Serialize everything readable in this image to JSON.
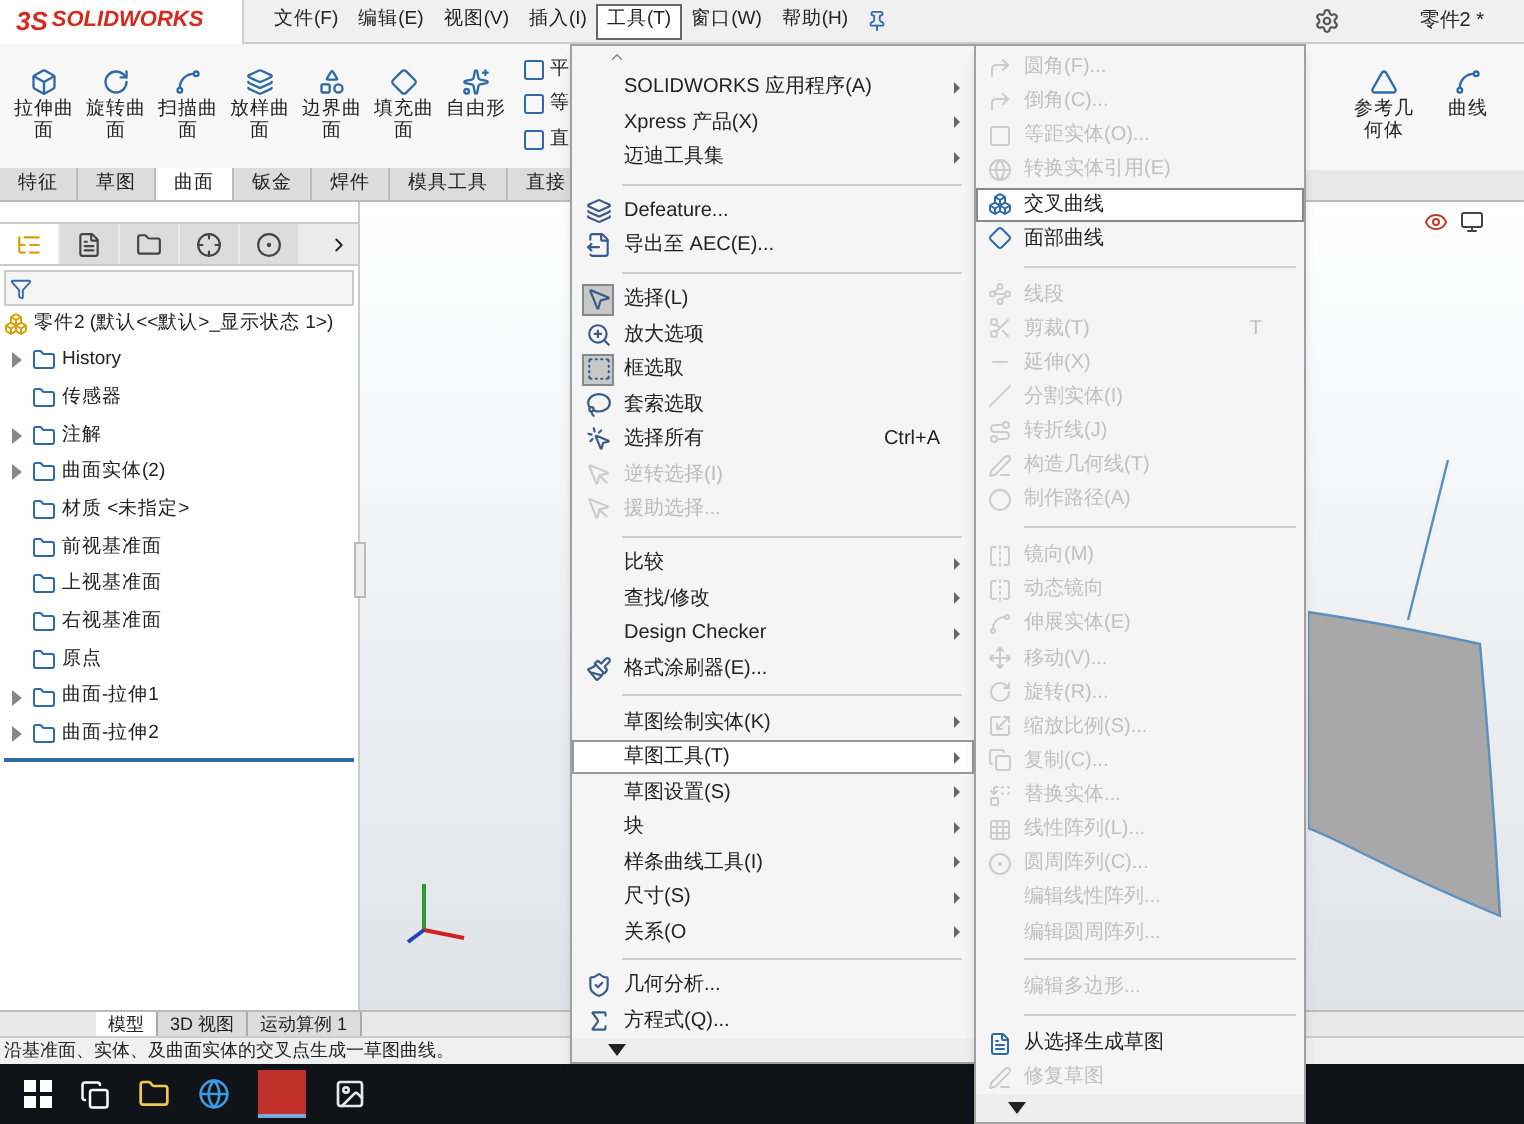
{
  "app": {
    "logo": "SOLIDWORKS",
    "logo_prefix": "3S",
    "document_title": "零件2 *"
  },
  "menu_bar": [
    {
      "label": "文件(F)",
      "selected": false
    },
    {
      "label": "编辑(E)",
      "selected": false
    },
    {
      "label": "视图(V)",
      "selected": false
    },
    {
      "label": "插入(I)",
      "selected": false
    },
    {
      "label": "工具(T)",
      "selected": true
    },
    {
      "label": "窗口(W)",
      "selected": false
    },
    {
      "label": "帮助(H)",
      "selected": false
    }
  ],
  "command_toolbar": [
    {
      "label": "拉伸曲面"
    },
    {
      "label": "旋转曲面"
    },
    {
      "label": "扫描曲面"
    },
    {
      "label": "放样曲面"
    },
    {
      "label": "边界曲面"
    },
    {
      "label": "填充曲面"
    },
    {
      "label": "自由形"
    }
  ],
  "command_column": [
    "平",
    "等",
    "直"
  ],
  "command_right": [
    {
      "label": "参考几何体"
    },
    {
      "label": "曲线"
    }
  ],
  "command_tabs": [
    {
      "label": "特征",
      "selected": false
    },
    {
      "label": "草图",
      "selected": false
    },
    {
      "label": "曲面",
      "selected": true
    },
    {
      "label": "钣金",
      "selected": false
    },
    {
      "label": "焊件",
      "selected": false
    },
    {
      "label": "模具工具",
      "selected": false
    },
    {
      "label": "直接",
      "selected": false
    }
  ],
  "panel_tabs": [
    {
      "selected": true
    },
    {
      "selected": false
    },
    {
      "selected": false
    },
    {
      "selected": false
    },
    {
      "selected": false
    }
  ],
  "feature_tree": {
    "root": "零件2 (默认<<默认>_显示状态 1>)",
    "items": [
      {
        "kind": "folder",
        "label": "History",
        "expanded": false
      },
      {
        "kind": "leaf",
        "label": "传感器"
      },
      {
        "kind": "folder",
        "label": "注解",
        "expanded": false
      },
      {
        "kind": "folder",
        "label": "曲面实体(2)",
        "expanded": false
      },
      {
        "kind": "leaf",
        "label": "材质 <未指定>"
      },
      {
        "kind": "leaf",
        "label": "前视基准面"
      },
      {
        "kind": "leaf",
        "label": "上视基准面"
      },
      {
        "kind": "leaf",
        "label": "右视基准面"
      },
      {
        "kind": "leaf",
        "label": "原点"
      },
      {
        "kind": "folder",
        "label": "曲面-拉伸1",
        "expanded": false
      },
      {
        "kind": "folder",
        "label": "曲面-拉伸2",
        "expanded": false
      }
    ]
  },
  "tools_menu": [
    {
      "kind": "item",
      "label": "SOLIDWORKS 应用程序(A)",
      "has_submenu": true,
      "disabled": false,
      "selected": false,
      "checked": false
    },
    {
      "kind": "item",
      "label": "Xpress 产品(X)",
      "has_submenu": true,
      "disabled": false,
      "selected": false,
      "checked": false
    },
    {
      "kind": "item",
      "label": "迈迪工具集",
      "has_submenu": true,
      "disabled": false,
      "selected": false,
      "checked": false
    },
    {
      "kind": "separator"
    },
    {
      "kind": "item",
      "label": "Defeature...",
      "has_submenu": false,
      "disabled": false,
      "selected": false,
      "checked": false
    },
    {
      "kind": "item",
      "label": "导出至 AEC(E)...",
      "has_submenu": false,
      "disabled": false,
      "selected": false,
      "checked": false
    },
    {
      "kind": "separator"
    },
    {
      "kind": "item",
      "label": "选择(L)",
      "has_submenu": false,
      "disabled": false,
      "selected": false,
      "checked": true
    },
    {
      "kind": "item",
      "label": "放大选项",
      "has_submenu": false,
      "disabled": false,
      "selected": false,
      "checked": false
    },
    {
      "kind": "item",
      "label": "框选取",
      "has_submenu": false,
      "disabled": false,
      "selected": false,
      "checked": true
    },
    {
      "kind": "item",
      "label": "套索选取",
      "has_submenu": false,
      "disabled": false,
      "selected": false,
      "checked": false
    },
    {
      "kind": "item",
      "label": "选择所有",
      "shortcut": "Ctrl+A",
      "has_submenu": false,
      "disabled": false,
      "selected": false,
      "checked": false
    },
    {
      "kind": "item",
      "label": "逆转选择(I)",
      "has_submenu": false,
      "disabled": true,
      "selected": false,
      "checked": false
    },
    {
      "kind": "item",
      "label": "援助选择...",
      "has_submenu": false,
      "disabled": true,
      "selected": false,
      "checked": false
    },
    {
      "kind": "separator"
    },
    {
      "kind": "item",
      "label": "比较",
      "has_submenu": true,
      "disabled": false,
      "selected": false,
      "checked": false
    },
    {
      "kind": "item",
      "label": "查找/修改",
      "has_submenu": true,
      "disabled": false,
      "selected": false,
      "checked": false
    },
    {
      "kind": "item",
      "label": "Design Checker",
      "has_submenu": true,
      "disabled": false,
      "selected": false,
      "checked": false
    },
    {
      "kind": "item",
      "label": "格式涂刷器(E)...",
      "has_submenu": false,
      "disabled": false,
      "selected": false,
      "checked": false
    },
    {
      "kind": "separator"
    },
    {
      "kind": "item",
      "label": "草图绘制实体(K)",
      "has_submenu": true,
      "disabled": false,
      "selected": false,
      "checked": false
    },
    {
      "kind": "item",
      "label": "草图工具(T)",
      "has_submenu": true,
      "disabled": false,
      "selected": true,
      "checked": false
    },
    {
      "kind": "item",
      "label": "草图设置(S)",
      "has_submenu": true,
      "disabled": false,
      "selected": false,
      "checked": false
    },
    {
      "kind": "item",
      "label": "块",
      "has_submenu": true,
      "disabled": false,
      "selected": false,
      "checked": false
    },
    {
      "kind": "item",
      "label": "样条曲线工具(I)",
      "has_submenu": true,
      "disabled": false,
      "selected": false,
      "checked": false
    },
    {
      "kind": "item",
      "label": "尺寸(S)",
      "has_submenu": true,
      "disabled": false,
      "selected": false,
      "checked": false
    },
    {
      "kind": "item",
      "label": "关系(O",
      "has_submenu": true,
      "disabled": false,
      "selected": false,
      "checked": false
    },
    {
      "kind": "separator"
    },
    {
      "kind": "item",
      "label": "几何分析...",
      "has_submenu": false,
      "disabled": false,
      "selected": false,
      "checked": false
    },
    {
      "kind": "item",
      "label": "方程式(Q)...",
      "has_submenu": false,
      "disabled": false,
      "selected": false,
      "checked": false
    }
  ],
  "sketch_tools_menu": [
    {
      "kind": "item",
      "label": "圆角(F)...",
      "disabled": true,
      "selected": false
    },
    {
      "kind": "item",
      "label": "倒角(C)...",
      "disabled": true,
      "selected": false
    },
    {
      "kind": "item",
      "label": "等距实体(O)...",
      "disabled": true,
      "selected": false
    },
    {
      "kind": "item",
      "label": "转换实体引用(E)",
      "disabled": true,
      "selected": false
    },
    {
      "kind": "item",
      "label": "交叉曲线",
      "disabled": false,
      "selected": true
    },
    {
      "kind": "item",
      "label": "面部曲线",
      "disabled": false,
      "selected": false
    },
    {
      "kind": "separator"
    },
    {
      "kind": "item",
      "label": "线段",
      "disabled": true,
      "selected": false
    },
    {
      "kind": "item",
      "label": "剪裁(T)",
      "shortcut": "T",
      "disabled": true,
      "selected": false
    },
    {
      "kind": "item",
      "label": "延伸(X)",
      "disabled": true,
      "selected": false
    },
    {
      "kind": "item",
      "label": "分割实体(I)",
      "disabled": true,
      "selected": false
    },
    {
      "kind": "item",
      "label": "转折线(J)",
      "disabled": true,
      "selected": false
    },
    {
      "kind": "item",
      "label": "构造几何线(T)",
      "disabled": true,
      "selected": false
    },
    {
      "kind": "item",
      "label": "制作路径(A)",
      "disabled": true,
      "selected": false
    },
    {
      "kind": "separator"
    },
    {
      "kind": "item",
      "label": "镜向(M)",
      "disabled": true,
      "selected": false
    },
    {
      "kind": "item",
      "label": "动态镜向",
      "disabled": true,
      "selected": false
    },
    {
      "kind": "item",
      "label": "伸展实体(E)",
      "disabled": true,
      "selected": false
    },
    {
      "kind": "item",
      "label": "移动(V)...",
      "disabled": true,
      "selected": false
    },
    {
      "kind": "item",
      "label": "旋转(R)...",
      "disabled": true,
      "selected": false
    },
    {
      "kind": "item",
      "label": "缩放比例(S)...",
      "disabled": true,
      "selected": false
    },
    {
      "kind": "item",
      "label": "复制(C)...",
      "disabled": true,
      "selected": false
    },
    {
      "kind": "item",
      "label": "替换实体...",
      "disabled": true,
      "selected": false
    },
    {
      "kind": "item",
      "label": "线性阵列(L)...",
      "disabled": true,
      "selected": false
    },
    {
      "kind": "item",
      "label": "圆周阵列(C)...",
      "disabled": true,
      "selected": false
    },
    {
      "kind": "item",
      "label": "编辑线性阵列...",
      "disabled": true,
      "selected": false
    },
    {
      "kind": "item",
      "label": "编辑圆周阵列...",
      "disabled": true,
      "selected": false
    },
    {
      "kind": "separator"
    },
    {
      "kind": "item",
      "label": "编辑多边形...",
      "disabled": true,
      "selected": false
    },
    {
      "kind": "separator"
    },
    {
      "kind": "item",
      "label": "从选择生成草图",
      "disabled": false,
      "selected": false
    },
    {
      "kind": "item",
      "label": "修复草图",
      "disabled": true,
      "selected": false
    }
  ],
  "bottom_tabs": [
    {
      "label": "模型",
      "selected": true
    },
    {
      "label": "3D 视图",
      "selected": false
    },
    {
      "label": "运动算例 1",
      "selected": false
    }
  ],
  "status_bar": "沿基准面、实体、及曲面实体的交叉点生成一草图曲线。"
}
